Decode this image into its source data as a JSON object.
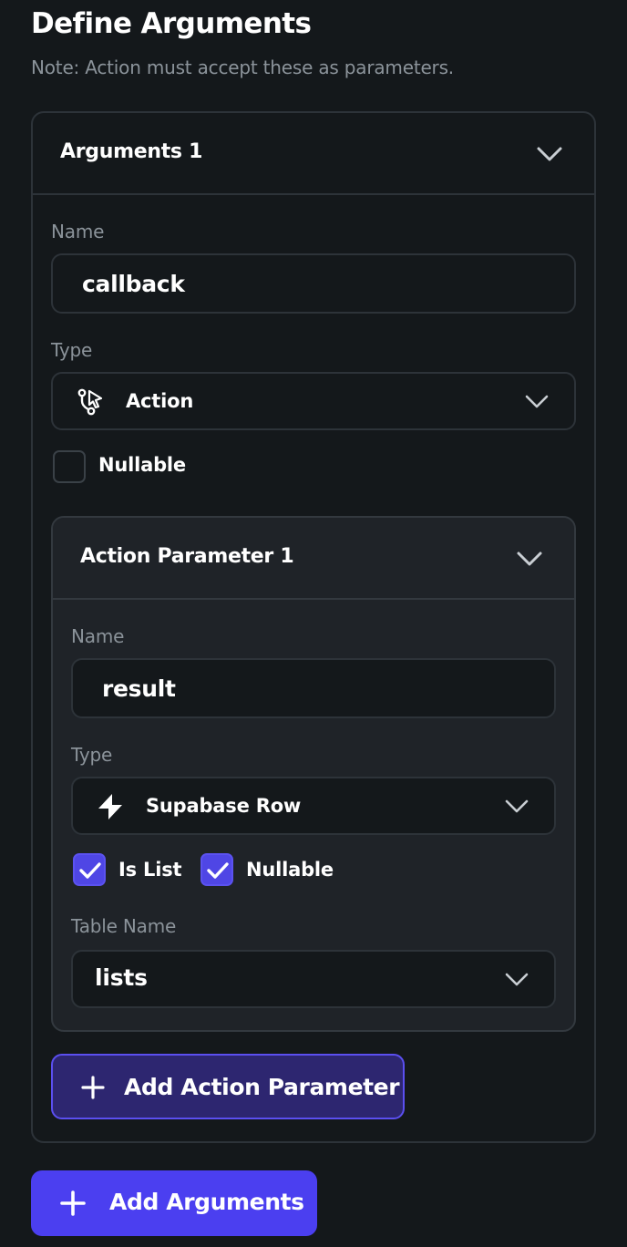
{
  "header": {
    "title": "Define Arguments",
    "note": "Note: Action must accept these as parameters."
  },
  "argument": {
    "title": "Arguments 1",
    "name_label": "Name",
    "name_value": "callback",
    "type_label": "Type",
    "type_value": "Action",
    "type_icon": "action-flow-icon",
    "nullable_label": "Nullable",
    "nullable_checked": false
  },
  "action_parameter": {
    "title": "Action Parameter 1",
    "name_label": "Name",
    "name_value": "result",
    "type_label": "Type",
    "type_value": "Supabase Row",
    "type_icon": "supabase-icon",
    "is_list_label": "Is List",
    "is_list_checked": true,
    "nullable_label": "Nullable",
    "nullable_checked": true,
    "table_label": "Table Name",
    "table_value": "lists"
  },
  "buttons": {
    "add_action_parameter": "Add Action Parameter",
    "add_arguments": "Add Arguments"
  },
  "colors": {
    "background": "#14181b",
    "accent": "#4b3ff0",
    "border": "#2d3339",
    "muted_text": "#8b939a"
  }
}
